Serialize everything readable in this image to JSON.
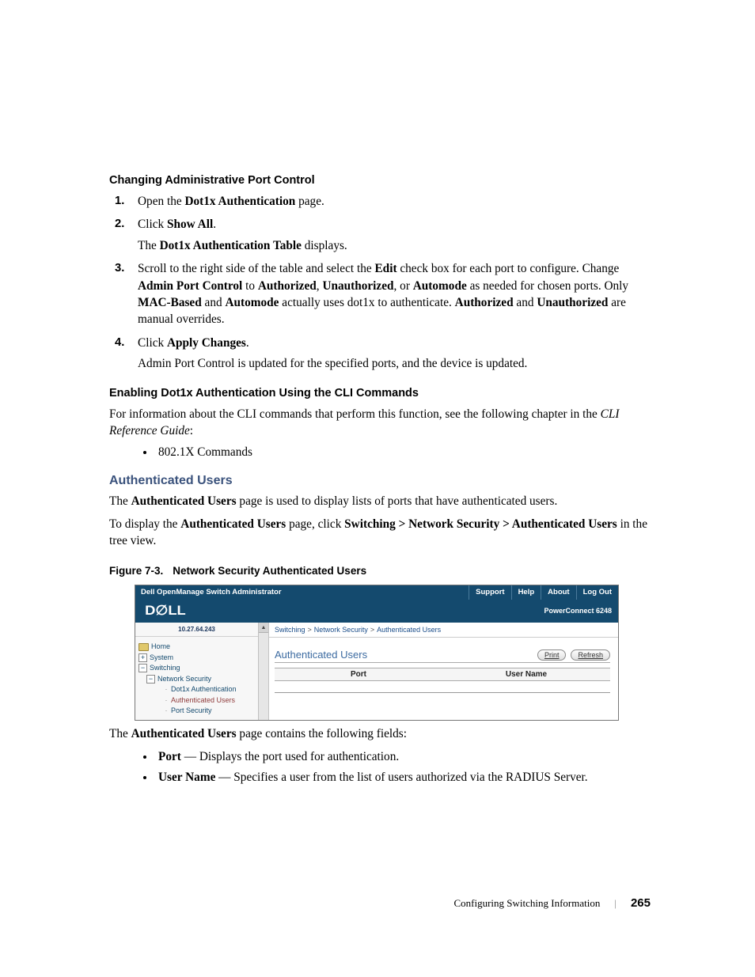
{
  "h_changing": "Changing Administrative Port Control",
  "step1_a": "Open the ",
  "step1_b": "Dot1x Authentication",
  "step1_c": " page.",
  "step2_a": "Click ",
  "step2_b": "Show All",
  "step2_c": ".",
  "step2_2a": "The ",
  "step2_2b": "Dot1x Authentication Table",
  "step2_2c": " displays.",
  "step3_a": "Scroll to the right side of the table and select the ",
  "step3_b": "Edit",
  "step3_c": " check box for each port to configure. Change ",
  "step3_d": "Admin Port Control",
  "step3_e": " to ",
  "step3_f": "Authorized",
  "step3_g": ", ",
  "step3_h": "Unauthorized",
  "step3_i": ", or ",
  "step3_j": "Automode",
  "step3_k": " as needed for chosen ports. Only ",
  "step3_l": "MAC-Based",
  "step3_m": " and ",
  "step3_n": "Automode",
  "step3_o": " actually uses dot1x to authenticate. ",
  "step3_p": "Authorized",
  "step3_q": " and ",
  "step3_r": "Unauthorized",
  "step3_s": " are manual overrides.",
  "step4_a": "Click ",
  "step4_b": "Apply Changes",
  "step4_c": ".",
  "step4_2": "Admin Port Control is updated for the specified ports, and the device is updated.",
  "h_cli": "Enabling Dot1x Authentication Using the CLI Commands",
  "cli_p_a": "For information about the CLI commands that perform this function, see the following chapter in the ",
  "cli_p_b": "CLI Reference Guide",
  "cli_p_c": ":",
  "cli_bullet": "802.1X Commands",
  "h_auth": "Authenticated Users",
  "auth_p1_a": "The ",
  "auth_p1_b": "Authenticated Users",
  "auth_p1_c": " page is used to display lists of ports that have authenticated users.",
  "auth_p2_a": "To display the ",
  "auth_p2_b": "Authenticated Users",
  "auth_p2_c": " page, click ",
  "auth_p2_d": "Switching > Network Security > Authenticated Users",
  "auth_p2_e": " in the tree view.",
  "figcap_a": "Figure 7-3.",
  "figcap_b": "Network Security Authenticated Users",
  "shot": {
    "top_title": "Dell OpenManage Switch Administrator",
    "links": [
      "Support",
      "Help",
      "About",
      "Log Out"
    ],
    "product": "PowerConnect 6248",
    "ip": "10.27.64.243",
    "tree": {
      "home": "Home",
      "system": "System",
      "switching": "Switching",
      "netsec": "Network Security",
      "dot1x": "Dot1x Authentication",
      "authu": "Authenticated Users",
      "portsec": "Port Security"
    },
    "crumb": [
      "Switching",
      "Network Security",
      "Authenticated Users"
    ],
    "panel_title": "Authenticated Users",
    "btn_print": "Print",
    "btn_refresh": "Refresh",
    "cols": [
      "Port",
      "User Name"
    ]
  },
  "post_p_a": "The ",
  "post_p_b": "Authenticated Users",
  "post_p_c": " page contains the following fields:",
  "bullet_port_a": "Port",
  "bullet_port_b": " — Displays the port used for authentication.",
  "bullet_uname_a": "User Name",
  "bullet_uname_b": " — Specifies a user from the list of users authorized via the RADIUS Server.",
  "footer_section": "Configuring Switching Information",
  "footer_page": "265"
}
